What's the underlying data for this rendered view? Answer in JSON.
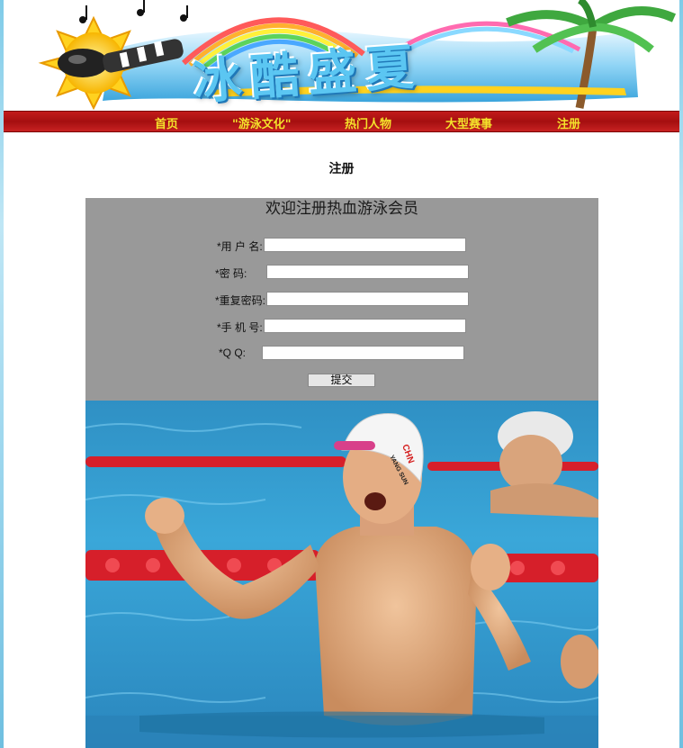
{
  "banner": {
    "title": "冰酷盛夏"
  },
  "nav": {
    "items": [
      {
        "label": "首页"
      },
      {
        "label": "\"游泳文化\""
      },
      {
        "label": "热门人物"
      },
      {
        "label": "大型赛事"
      },
      {
        "label": "注册"
      }
    ]
  },
  "page": {
    "heading": "注册"
  },
  "form": {
    "title": "欢迎注册热血游泳会员",
    "fields": [
      {
        "label": "*用 户 名:",
        "value": ""
      },
      {
        "label": "*密    码:",
        "value": ""
      },
      {
        "label": "*重复密码:",
        "value": ""
      },
      {
        "label": "*手 机 号:",
        "value": ""
      },
      {
        "label": "*Q     Q:",
        "value": ""
      }
    ],
    "submit_label": "提交"
  },
  "photo": {
    "cap_text_1": "YANG SUN",
    "cap_text_2": "CHN"
  }
}
